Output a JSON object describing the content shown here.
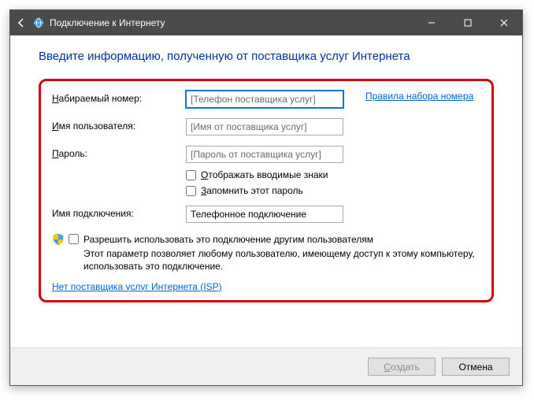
{
  "window": {
    "title": "Подключение к Интернету"
  },
  "heading": "Введите информацию, полученную от поставщика услуг Интернета",
  "fields": {
    "dial_number": {
      "label_pre": "Н",
      "label_rest": "абираемый номер:",
      "placeholder": "[Телефон поставщика услуг]",
      "value": ""
    },
    "dial_rules_link": "Правила набора номера",
    "username": {
      "label_pre": "И",
      "label_rest": "мя пользователя:",
      "placeholder": "[Имя от поставщика услуг]",
      "value": ""
    },
    "password": {
      "label_pre": "П",
      "label_rest": "ароль:",
      "placeholder": "[Пароль от поставщика услуг]",
      "value": ""
    },
    "show_chars": {
      "label_pre": "О",
      "label_rest": "тображать вводимые знаки"
    },
    "remember": {
      "label_pre": "З",
      "label_rest": "апомнить этот пароль"
    },
    "conn_name": {
      "label_rest": "Имя подключения:",
      "value": "Телефонное подключение"
    },
    "share": {
      "label_pre": "Р",
      "label_rest": "азрешить использовать это подключение другим пользователям",
      "description": "Этот параметр позволяет любому пользователю, имеющему доступ к этому компьютеру, использовать это подключение."
    },
    "isp_link": "Нет поставщика услуг Интернета (ISP)"
  },
  "buttons": {
    "create_pre": "С",
    "create_rest": "оздать",
    "cancel": "Отмена"
  }
}
